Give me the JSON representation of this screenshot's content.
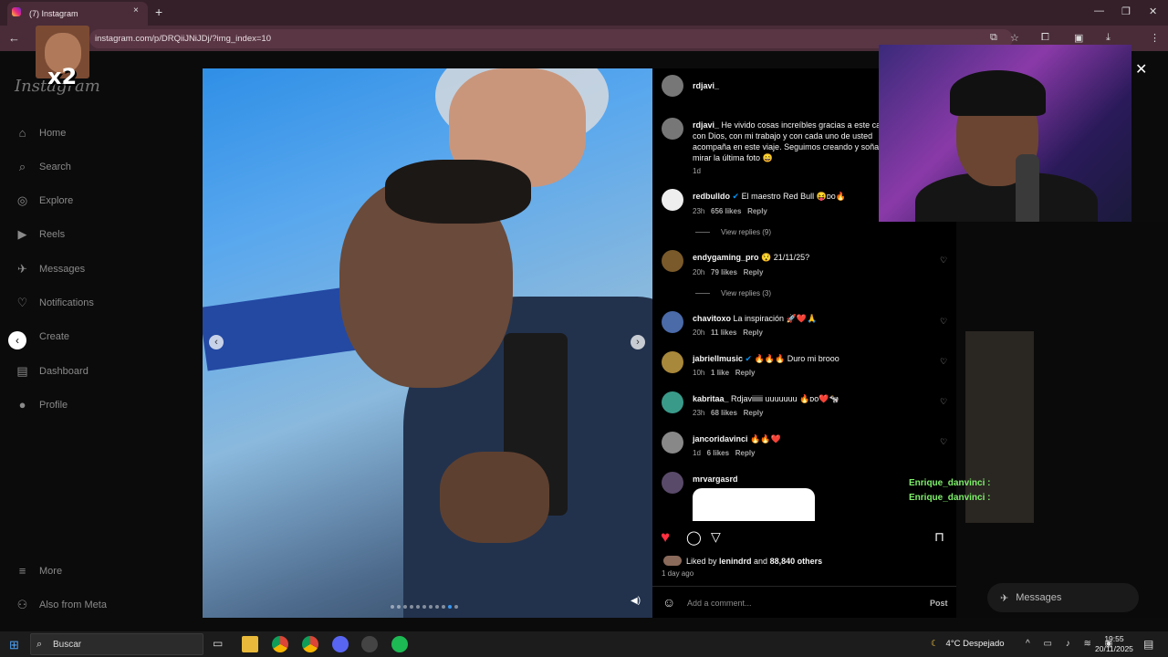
{
  "browser": {
    "tab_title": "(7) Instagram",
    "tab_close": "×",
    "new_tab": "+",
    "url": "instagram.com/p/DRQiiJNiJDj/?img_index=10",
    "back": "←",
    "win_min": "—",
    "win_restore": "❐",
    "win_close": "✕"
  },
  "meme_overlay": {
    "label": "x2"
  },
  "sidebar": {
    "logo": "Instagram",
    "items": [
      {
        "label": "Home",
        "icon": "⌂"
      },
      {
        "label": "Search",
        "icon": "⌕"
      },
      {
        "label": "Explore",
        "icon": "◎"
      },
      {
        "label": "Reels",
        "icon": "▶"
      },
      {
        "label": "Messages",
        "icon": "✈"
      },
      {
        "label": "Notifications",
        "icon": "♡"
      },
      {
        "label": "Create",
        "icon": "+"
      },
      {
        "label": "Dashboard",
        "icon": "▤"
      },
      {
        "label": "Profile",
        "icon": "●"
      }
    ],
    "more": {
      "label": "More",
      "icon": "≡"
    },
    "also": {
      "label": "Also from Meta",
      "icon": "⚇"
    }
  },
  "post": {
    "author": "rdjavi_",
    "caption_user": "rdjavi_",
    "caption_text": "He vivido cosas increíbles gracias a este ca con Dios, con mi trabajo y con cada uno de usted acompaña en este viaje. Seguimos creando y soña mirar la última foto 😄",
    "caption_time": "1d",
    "comments": [
      {
        "user": "redbulldo",
        "verified": true,
        "text": "El maestro Red Bull 😝ᴅᴏ🔥",
        "time": "23h",
        "likes": "656 likes",
        "reply": "Reply",
        "view_replies": "View replies (9)"
      },
      {
        "user": "endygaming_pro",
        "verified": false,
        "text": "😯 21/11/25?",
        "time": "20h",
        "likes": "79 likes",
        "reply": "Reply",
        "view_replies": "View replies (3)"
      },
      {
        "user": "chavitoxo",
        "verified": false,
        "text": "La inspiración 🚀❤️🙏",
        "time": "20h",
        "likes": "11 likes",
        "reply": "Reply"
      },
      {
        "user": "jabriellmusic",
        "verified": true,
        "text": "🔥🔥🔥 Duro mi brooo",
        "time": "10h",
        "likes": "1 like",
        "reply": "Reply"
      },
      {
        "user": "kabritaa_",
        "verified": false,
        "text": "Rdjaviiiiii uuuuuuu 🔥ᴅᴏ❤️🐄",
        "time": "23h",
        "likes": "68 likes",
        "reply": "Reply"
      },
      {
        "user": "jancoridavinci",
        "verified": false,
        "text": "🔥🔥❤️",
        "time": "1d",
        "likes": "6 likes",
        "reply": "Reply"
      },
      {
        "user": "mrvargasrd",
        "verified": false,
        "text": "",
        "time": "",
        "likes": "",
        "reply": ""
      }
    ],
    "liked_by_prefix": "Liked by ",
    "liked_by_user": "lenindrd",
    "liked_by_mid": " and ",
    "liked_by_others": "88,840 others",
    "post_time": "1 day ago",
    "comment_placeholder": "Add a comment...",
    "post_button": "Post"
  },
  "chat": [
    {
      "user": "Enrique_danvinci :"
    },
    {
      "user": "Enrique_danvinci :"
    }
  ],
  "messages_pill": "Messages",
  "close_overlay": "✕",
  "taskbar": {
    "search_label": "Buscar",
    "weather": "4°C  Despejado",
    "time": "19:55",
    "date": "20/11/2025"
  },
  "carousel": {
    "current_index": 10,
    "total": 11
  },
  "colors": {
    "like_red": "#ff3040",
    "link_blue": "#0095f6",
    "chat_green": "#7ef06b"
  }
}
